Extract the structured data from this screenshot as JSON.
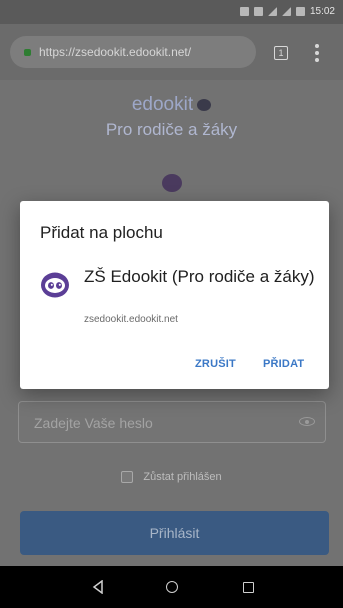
{
  "status_bar": {
    "time": "15:02"
  },
  "browser": {
    "url": "https://zsedookit.edookit.net/",
    "tab_count": "1"
  },
  "page": {
    "brand": "edookit",
    "subtitle": "Pro rodiče a žáky",
    "password_placeholder": "Zadejte Vaše heslo",
    "remember_label": "Zůstat přihlášen",
    "login_button": "Přihlásit"
  },
  "dialog": {
    "title": "Přidat na plochu",
    "app_name": "ZŠ Edookit (Pro rodiče a žáky)",
    "app_url": "zsedookit.edookit.net",
    "cancel_label": "ZRUŠIT",
    "add_label": "PŘIDAT"
  },
  "colors": {
    "accent": "#3b78c6",
    "logo_purple": "#5b3e96"
  },
  "icons": {
    "lock": "lock-icon",
    "tabs": "tabs-icon",
    "menu": "more-vert-icon",
    "eye": "eye-icon",
    "app": "edookit-logo-icon"
  }
}
